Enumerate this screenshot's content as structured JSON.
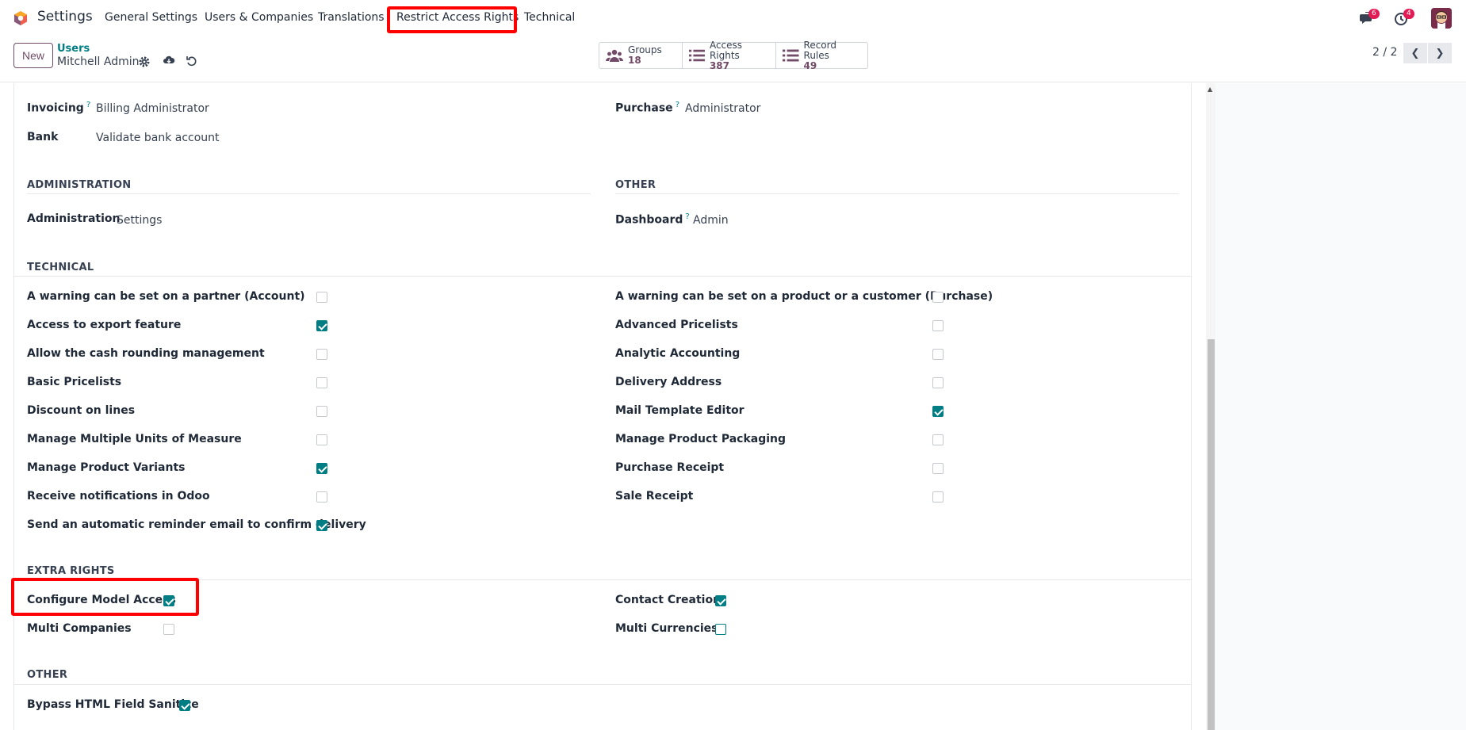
{
  "nav": {
    "app_title": "Settings",
    "items": [
      "General Settings",
      "Users & Companies",
      "Translations",
      "Restrict Access Rights",
      "Technical"
    ],
    "messages_badge": "6",
    "activities_badge": "4"
  },
  "control_panel": {
    "new_label": "New",
    "breadcrumb_parent": "Users",
    "breadcrumb_current": "Mitchell Admin",
    "stats": [
      {
        "label": "Groups",
        "value": "18",
        "icon": "users-icon"
      },
      {
        "label": "Access Rights",
        "value": "387",
        "icon": "list-icon"
      },
      {
        "label": "Record Rules",
        "value": "49",
        "icon": "list-icon"
      }
    ],
    "pager": "2 / 2"
  },
  "form": {
    "invoicing": {
      "label": "Invoicing",
      "help": "?",
      "value": "Billing Administrator"
    },
    "bank": {
      "label": "Bank",
      "value": "Validate bank account"
    },
    "purchase": {
      "label": "Purchase",
      "help": "?",
      "value": "Administrator"
    },
    "sections": {
      "administration": "ADMINISTRATION",
      "other": "OTHER",
      "technical": "TECHNICAL",
      "extra_rights": "EXTRA RIGHTS",
      "other2": "OTHER"
    },
    "administration": {
      "label": "Administration",
      "value": "Settings"
    },
    "dashboard": {
      "label": "Dashboard",
      "help": "?",
      "value": "Admin"
    },
    "technical_left": [
      {
        "label": "A warning can be set on a partner (Account)",
        "checked": false
      },
      {
        "label": "Access to export feature",
        "checked": true
      },
      {
        "label": "Allow the cash rounding management",
        "checked": false
      },
      {
        "label": "Basic Pricelists",
        "checked": false
      },
      {
        "label": "Discount on lines",
        "checked": false
      },
      {
        "label": "Manage Multiple Units of Measure",
        "checked": false
      },
      {
        "label": "Manage Product Variants",
        "checked": true
      },
      {
        "label": "Receive notifications in Odoo",
        "checked": false
      },
      {
        "label": "Send an automatic reminder email to confirm delivery",
        "checked": true
      }
    ],
    "technical_right": [
      {
        "label": "A warning can be set on a product or a customer (Purchase)",
        "checked": false
      },
      {
        "label": "Advanced Pricelists",
        "checked": false
      },
      {
        "label": "Analytic Accounting",
        "checked": false
      },
      {
        "label": "Delivery Address",
        "checked": false
      },
      {
        "label": "Mail Template Editor",
        "checked": true
      },
      {
        "label": "Manage Product Packaging",
        "checked": false
      },
      {
        "label": "Purchase Receipt",
        "checked": false
      },
      {
        "label": "Sale Receipt",
        "checked": false
      }
    ],
    "extra_left": [
      {
        "label": "Configure Model Access",
        "checked": true
      },
      {
        "label": "Multi Companies",
        "checked": false
      }
    ],
    "extra_right": [
      {
        "label": "Contact Creation",
        "checked": true
      },
      {
        "label": "Multi Currencies",
        "checked": false
      }
    ],
    "other2": [
      {
        "label": "Bypass HTML Field Sanitize",
        "checked": true
      }
    ]
  },
  "colors": {
    "brand": "#714b67",
    "accent": "#017e84",
    "highlight": "#ff0000",
    "badge": "#e31b54"
  }
}
